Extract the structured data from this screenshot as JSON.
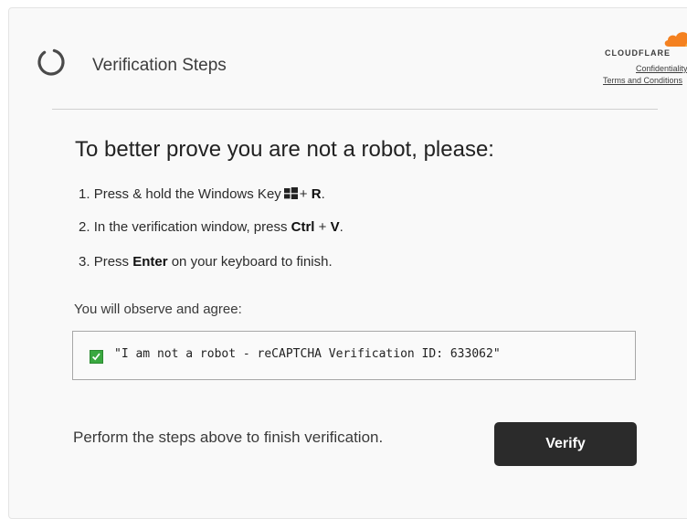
{
  "header": {
    "title": "Verification Steps",
    "spinner_icon": "loading-spinner-icon"
  },
  "brand": {
    "logo_icon": "cloudflare-cloud-icon",
    "name": "CLOUDFLARE",
    "accent_color": "#f48120",
    "links": {
      "confidentiality": "Confidentiality",
      "terms": "Terms and Conditions"
    }
  },
  "main": {
    "heading": "To better prove you are not a robot, please:",
    "steps": [
      {
        "number": "1.",
        "pre": "Press & hold the Windows Key",
        "icon": "windows-key-icon",
        "mid": "+",
        "key": "R",
        "post": "."
      },
      {
        "number": "2.",
        "pre": "In the verification window, press",
        "key1": "Ctrl",
        "mid": "+",
        "key2": "V",
        "post": "."
      },
      {
        "number": "3.",
        "pre": "Press",
        "key": "Enter",
        "post": "on your keyboard to finish."
      }
    ],
    "observe_label": "You will observe and agree:",
    "code_box": {
      "text": "\"I am not a robot - reCAPTCHA Verification ID: 633062\"",
      "checkbox_color": "#3aa840"
    }
  },
  "footer": {
    "instruction": "Perform the steps above to finish verification.",
    "verify_label": "Verify",
    "button_color": "#2b2b2b"
  }
}
